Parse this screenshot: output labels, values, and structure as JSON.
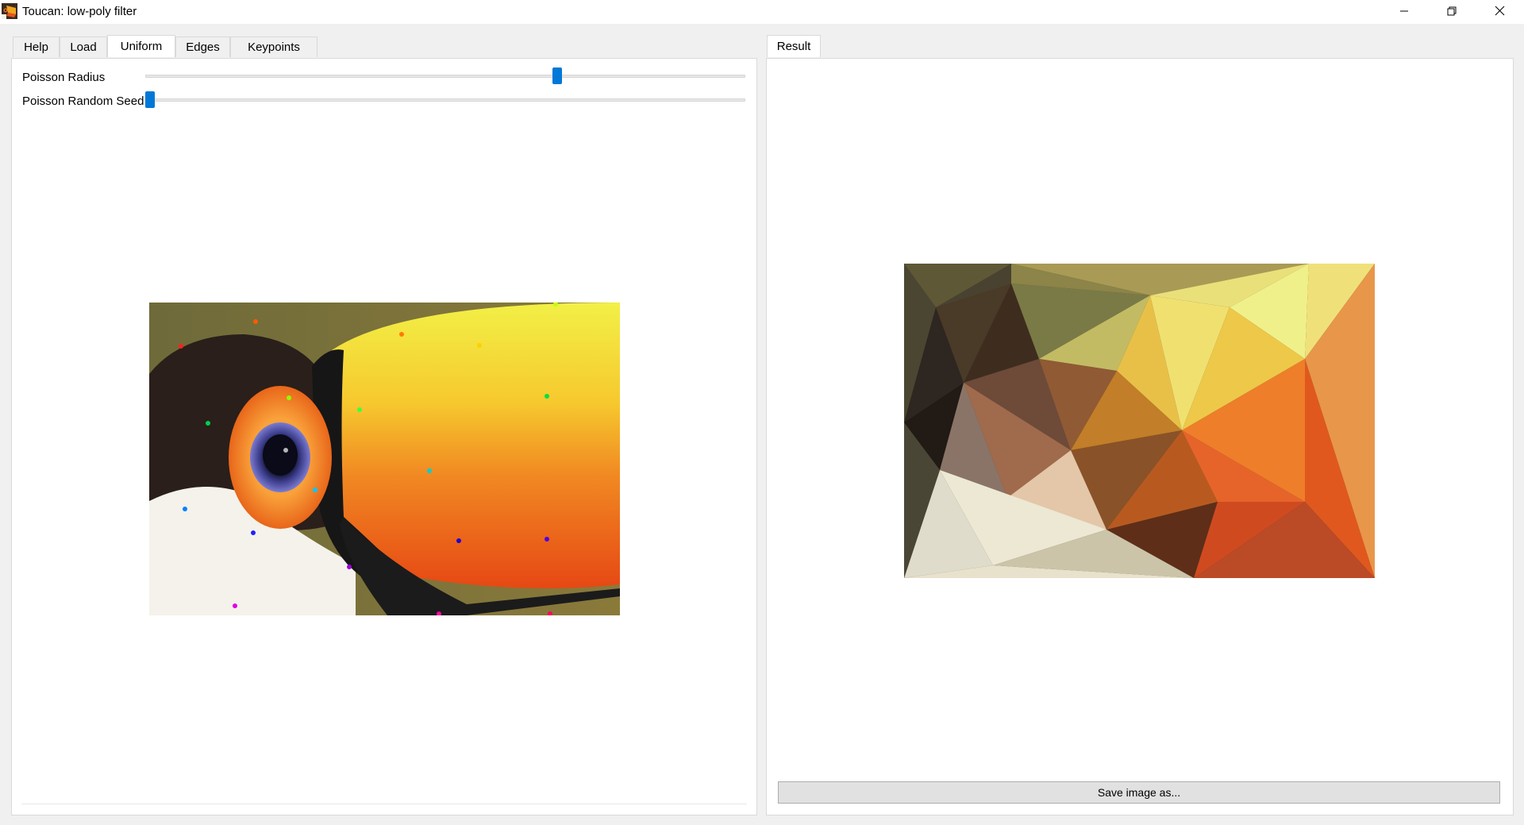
{
  "window": {
    "title": "Toucan: low-poly filter",
    "controls": [
      "minimize-icon",
      "restore-icon",
      "close-icon"
    ]
  },
  "left_panel": {
    "tabs": [
      {
        "label": "Help",
        "active": false
      },
      {
        "label": "Load",
        "active": false
      },
      {
        "label": "Uniform",
        "active": true
      },
      {
        "label": "Edges",
        "active": false
      },
      {
        "label": "Keypoints",
        "active": false
      }
    ],
    "sliders": [
      {
        "label": "Poisson Radius",
        "value_fraction": 0.69
      },
      {
        "label": "Poisson Random Seed",
        "value_fraction": 0.0
      }
    ]
  },
  "right_panel": {
    "tabs": [
      {
        "label": "Result",
        "active": true
      }
    ],
    "save_button": "Save image as..."
  },
  "colors": {
    "accent": "#0078d7",
    "background": "#f0f0f0",
    "panel": "#ffffff",
    "border": "#d9d9d9"
  }
}
